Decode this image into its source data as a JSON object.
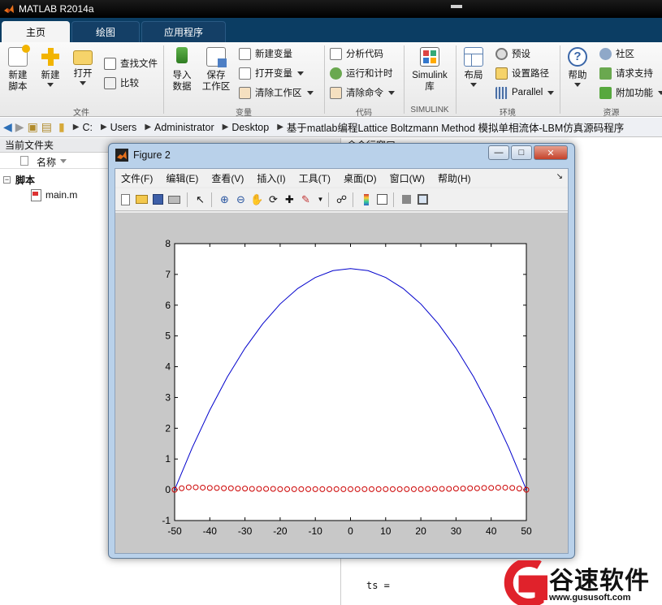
{
  "window": {
    "title": "MATLAB R2014a"
  },
  "ribbon": {
    "tabs": [
      "主页",
      "绘图",
      "应用程序"
    ],
    "active_tab": "主页",
    "file_group": {
      "label": "文件",
      "new_script": "新建\n脚本",
      "new": "新建",
      "open": "打开",
      "find_files": "查找文件",
      "compare": "比较"
    },
    "variable_group": {
      "label": "变量",
      "import": "导入\n数据",
      "save_workspace": "保存\n工作区",
      "new_variable": "新建变量",
      "open_variable": "打开变量",
      "clear_workspace": "清除工作区"
    },
    "code_group": {
      "label": "代码",
      "analyze": "分析代码",
      "run_time": "运行和计时",
      "clear_commands": "清除命令"
    },
    "simulink_group": {
      "label": "SIMULINK",
      "simulink": "Simulink\n库"
    },
    "env_group": {
      "label": "环境",
      "layout": "布局",
      "preferences": "预设",
      "set_path": "设置路径",
      "parallel": "Parallel"
    },
    "resources_group": {
      "label": "资源",
      "help": "帮助",
      "community": "社区",
      "request_support": "请求支持",
      "addons": "附加功能"
    }
  },
  "address": {
    "path": [
      "C:",
      "Users",
      "Administrator",
      "Desktop",
      "基于matlab编程Lattice Boltzmann Method 模拟单相流体-LBM仿真源码程序"
    ]
  },
  "current_folder": {
    "title": "当前文件夹",
    "column_name": "名称",
    "group": "脚本",
    "files": [
      "main.m"
    ]
  },
  "command_window": {
    "title": "命令行窗口",
    "last_line": "ts ="
  },
  "figure": {
    "title": "Figure 2",
    "menus": [
      "文件(F)",
      "编辑(E)",
      "查看(V)",
      "插入(I)",
      "工具(T)",
      "桌面(D)",
      "窗口(W)",
      "帮助(H)"
    ],
    "toolbar_icons": [
      "new-figure-icon",
      "open-file-icon",
      "save-icon",
      "print-icon",
      "pointer-icon",
      "zoom-in-icon",
      "zoom-out-icon",
      "pan-icon",
      "rotate-icon",
      "data-cursor-icon",
      "brush-icon",
      "link-icon",
      "colorbar-icon",
      "legend-icon",
      "hide-plot-tools-icon",
      "show-plot-tools-icon"
    ]
  },
  "chart_data": {
    "type": "line",
    "title": "",
    "xlabel": "",
    "ylabel": "",
    "xlim": [
      -50,
      50
    ],
    "ylim": [
      -1,
      8
    ],
    "xticks": [
      -50,
      -40,
      -30,
      -20,
      -10,
      0,
      10,
      20,
      30,
      40,
      50
    ],
    "yticks": [
      -1,
      0,
      1,
      2,
      3,
      4,
      5,
      6,
      7,
      8
    ],
    "grid": false,
    "series": [
      {
        "style": "line",
        "color": "#0000cc",
        "x": [
          -50,
          -45,
          -40,
          -35,
          -30,
          -25,
          -20,
          -15,
          -10,
          -5,
          0,
          5,
          10,
          15,
          20,
          25,
          30,
          35,
          40,
          45,
          50
        ],
        "y": [
          0,
          1.37,
          2.59,
          3.67,
          4.6,
          5.39,
          6.04,
          6.54,
          6.9,
          7.12,
          7.19,
          7.12,
          6.9,
          6.54,
          6.04,
          5.39,
          4.6,
          3.67,
          2.59,
          1.37,
          0
        ]
      },
      {
        "style": "markers",
        "marker": "circle",
        "color": "#cc0000",
        "x": [
          -50,
          -48,
          -46,
          -44,
          -42,
          -40,
          -38,
          -36,
          -34,
          -32,
          -30,
          -28,
          -26,
          -24,
          -22,
          -20,
          -18,
          -16,
          -14,
          -12,
          -10,
          -8,
          -6,
          -4,
          -2,
          0,
          2,
          4,
          6,
          8,
          10,
          12,
          14,
          16,
          18,
          20,
          22,
          24,
          26,
          28,
          30,
          32,
          34,
          36,
          38,
          40,
          42,
          44,
          46,
          48,
          50
        ],
        "y": [
          0,
          0.05,
          0.08,
          0.08,
          0.07,
          0.06,
          0.06,
          0.05,
          0.05,
          0.04,
          0.04,
          0.03,
          0.03,
          0.03,
          0.03,
          0.02,
          0.02,
          0.02,
          0.02,
          0.02,
          0.02,
          0.02,
          0.02,
          0.02,
          0.02,
          0.02,
          0.02,
          0.02,
          0.02,
          0.02,
          0.02,
          0.02,
          0.02,
          0.02,
          0.02,
          0.02,
          0.03,
          0.03,
          0.03,
          0.03,
          0.04,
          0.04,
          0.05,
          0.05,
          0.06,
          0.06,
          0.07,
          0.07,
          0.06,
          0.04,
          0
        ]
      }
    ]
  },
  "watermark": {
    "brand": "谷速软件",
    "url": "www.gususoft.com",
    "color": "#e0222b"
  }
}
